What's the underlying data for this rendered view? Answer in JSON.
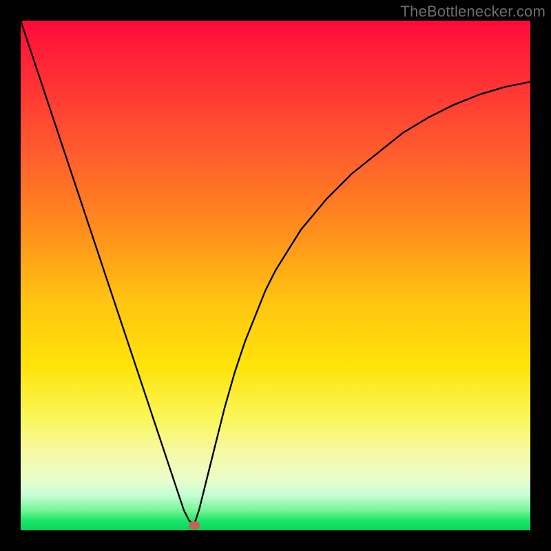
{
  "watermark": "TheBottlenecker.com",
  "colors": {
    "gradient_top": "#ff0a3a",
    "gradient_mid1": "#ff8a1e",
    "gradient_mid2": "#ffe40a",
    "gradient_bottom": "#0bd45f",
    "curve": "#000000",
    "marker": "#c0645c",
    "frame": "#000000"
  },
  "chart_data": {
    "type": "line",
    "title": "",
    "xlabel": "",
    "ylabel": "",
    "xlim": [
      0,
      100
    ],
    "ylim": [
      0,
      100
    ],
    "x": [
      0,
      2,
      4,
      6,
      8,
      10,
      12,
      14,
      16,
      18,
      20,
      22,
      24,
      26,
      28,
      30,
      31,
      32,
      33,
      34,
      35,
      36,
      38,
      40,
      42,
      44,
      46,
      48,
      50,
      55,
      60,
      65,
      70,
      75,
      80,
      85,
      90,
      95,
      100
    ],
    "values": [
      100,
      94,
      88,
      82,
      76,
      70,
      64,
      58,
      52,
      46,
      40,
      34,
      28,
      22,
      16,
      10,
      7,
      4,
      2,
      1,
      4,
      8,
      16,
      24,
      31,
      37,
      42,
      47,
      51,
      59,
      65,
      70,
      74,
      78,
      81,
      83.5,
      85.5,
      87,
      88
    ],
    "minimum": {
      "x": 34,
      "y": 1
    },
    "annotations": [],
    "legend": [],
    "grid": false
  }
}
